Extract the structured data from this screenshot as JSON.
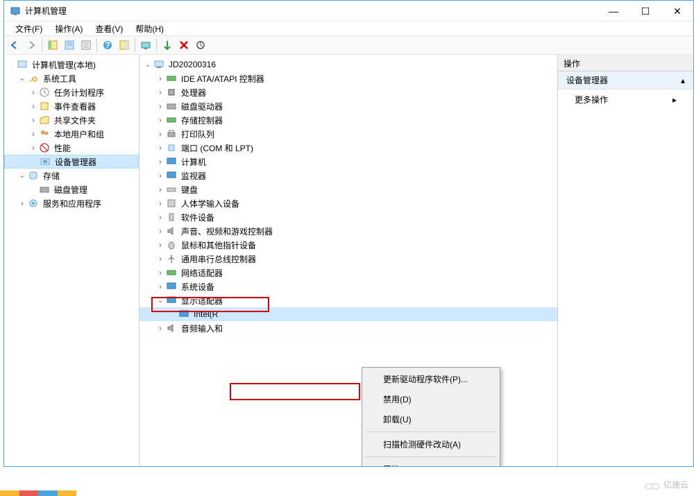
{
  "window": {
    "title": "计算机管理"
  },
  "menus": {
    "file": "文件(F)",
    "action": "操作(A)",
    "view": "查看(V)",
    "help": "帮助(H)"
  },
  "left_tree": {
    "root": "计算机管理(本地)",
    "system_tools": "系统工具",
    "task_scheduler": "任务计划程序",
    "event_viewer": "事件查看器",
    "shared_folders": "共享文件夹",
    "local_users": "本地用户和组",
    "performance": "性能",
    "device_manager": "设备管理器",
    "storage": "存储",
    "disk_management": "磁盘管理",
    "services_apps": "服务和应用程序"
  },
  "device_tree": {
    "computer": "JD20200316",
    "ide": "IDE ATA/ATAPI 控制器",
    "processors": "处理器",
    "disk_drives": "磁盘驱动器",
    "storage_controllers": "存储控制器",
    "print_queues": "打印队列",
    "ports": "端口 (COM 和 LPT)",
    "computers": "计算机",
    "monitors": "监视器",
    "keyboards": "键盘",
    "hid": "人体学输入设备",
    "software_devices": "软件设备",
    "sound": "声音、视频和游戏控制器",
    "mice": "鼠标和其他指针设备",
    "usb": "通用串行总线控制器",
    "network": "网络适配器",
    "system_devices": "系统设备",
    "display_adapters": "显示适配器",
    "intel_gpu": "Intel(R",
    "audio_io": "音频输入和"
  },
  "context_menu": {
    "update_driver": "更新驱动程序软件(P)...",
    "disable": "禁用(D)",
    "uninstall": "卸载(U)",
    "scan": "扫描检测硬件改动(A)",
    "properties": "属性(R)"
  },
  "right_panel": {
    "header": "操作",
    "section": "设备管理器",
    "more_actions": "更多操作"
  },
  "watermark": "亿速云"
}
